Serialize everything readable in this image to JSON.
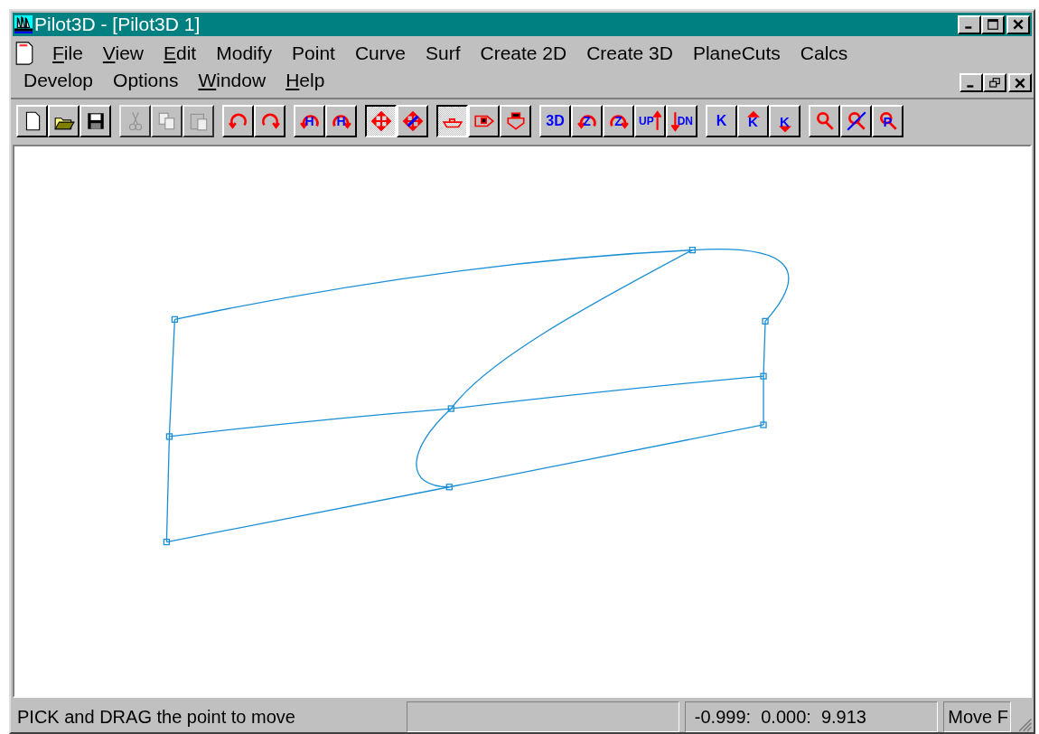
{
  "window": {
    "title": "Pilot3D - [Pilot3D 1]"
  },
  "menu": [
    {
      "label": "File",
      "underline_first": true
    },
    {
      "label": "View",
      "underline_first": true
    },
    {
      "label": "Edit",
      "underline_first": true
    },
    {
      "label": "Modify",
      "underline_first": false
    },
    {
      "label": "Point",
      "underline_first": false
    },
    {
      "label": "Curve",
      "underline_first": false
    },
    {
      "label": "Surf",
      "underline_first": false
    },
    {
      "label": "Create 2D",
      "underline_first": false
    },
    {
      "label": "Create 3D",
      "underline_first": false
    },
    {
      "label": "PlaneCuts",
      "underline_first": false
    },
    {
      "label": "Calcs",
      "underline_first": false
    },
    {
      "label": "Develop",
      "underline_first": false
    },
    {
      "label": "Options",
      "underline_first": false
    },
    {
      "label": "Window",
      "underline_first": true
    },
    {
      "label": "Help",
      "underline_first": true
    }
  ],
  "toolbar": [
    [
      {
        "kind": "new",
        "pressed": false,
        "disabled": false
      },
      {
        "kind": "open",
        "pressed": false,
        "disabled": false
      },
      {
        "kind": "save",
        "pressed": false,
        "disabled": false
      }
    ],
    [
      {
        "kind": "cut",
        "pressed": false,
        "disabled": true
      },
      {
        "kind": "copy",
        "pressed": false,
        "disabled": true
      },
      {
        "kind": "paste",
        "pressed": false,
        "disabled": true
      }
    ],
    [
      {
        "kind": "undo",
        "pressed": false,
        "disabled": false
      },
      {
        "kind": "redo",
        "pressed": false,
        "disabled": false
      }
    ],
    [
      {
        "kind": "rotate-left",
        "glyph": "H",
        "pressed": false,
        "disabled": false
      },
      {
        "kind": "rotate-right",
        "glyph": "H",
        "pressed": false,
        "disabled": false
      }
    ],
    [
      {
        "kind": "move",
        "pressed": true,
        "disabled": false
      },
      {
        "kind": "move-all",
        "pressed": false,
        "disabled": false
      }
    ],
    [
      {
        "kind": "boat-side",
        "pressed": true,
        "disabled": false
      },
      {
        "kind": "boat-plan",
        "pressed": false,
        "disabled": false
      },
      {
        "kind": "boat-front",
        "pressed": false,
        "disabled": false
      }
    ],
    [
      {
        "kind": "label",
        "glyph": "3D",
        "pressed": false,
        "disabled": false
      },
      {
        "kind": "rotate-left",
        "glyph": "Z",
        "pressed": false,
        "disabled": false
      },
      {
        "kind": "rotate-right",
        "glyph": "Z",
        "pressed": false,
        "disabled": false
      },
      {
        "kind": "up",
        "glyph": "UP",
        "pressed": false,
        "disabled": false
      },
      {
        "kind": "down",
        "glyph": "DN",
        "pressed": false,
        "disabled": false
      }
    ],
    [
      {
        "kind": "label",
        "glyph": "K",
        "pressed": false,
        "disabled": false
      },
      {
        "kind": "up-label",
        "glyph": "K",
        "pressed": false,
        "disabled": false
      },
      {
        "kind": "down-label",
        "glyph": "K",
        "pressed": false,
        "disabled": false
      }
    ],
    [
      {
        "kind": "zoom",
        "pressed": false,
        "disabled": false
      },
      {
        "kind": "zoom-off",
        "pressed": false,
        "disabled": false
      },
      {
        "kind": "zoom",
        "glyph": "P",
        "pressed": false,
        "disabled": false
      }
    ]
  ],
  "status_bar": {
    "message": "PICK and DRAG the point to move",
    "coordinates": "-0.999:  0.000:  9.913",
    "mode": "Move F"
  }
}
